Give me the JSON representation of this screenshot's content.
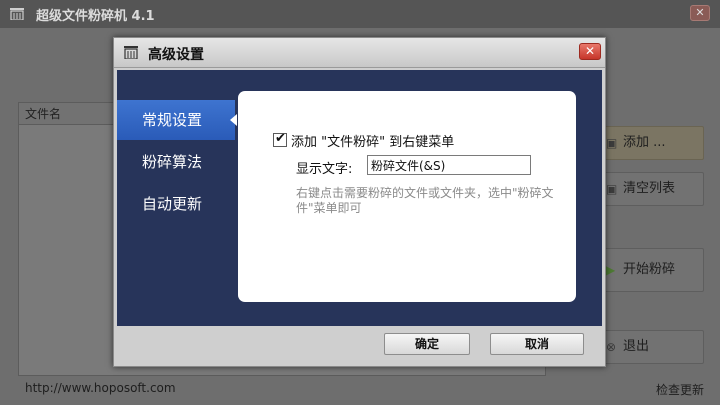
{
  "app": {
    "title": "超级文件粉碎机 4.1",
    "close_glyph": "✕",
    "file_column_header": "文件名",
    "buttons": {
      "add": "添加 ...",
      "clear": "清空列表",
      "start": "开始粉碎",
      "quit": "退出"
    },
    "footer_url": "http://www.hoposoft.com",
    "footer_link": "检查更新"
  },
  "dialog": {
    "title": "高级设置",
    "close_glyph": "✕",
    "nav": [
      {
        "label": "常规设置",
        "active": true
      },
      {
        "label": "粉碎算法",
        "active": false
      },
      {
        "label": "自动更新",
        "active": false
      }
    ],
    "general": {
      "context_menu_option": "添加 \"文件粉碎\" 到右键菜单",
      "context_menu_checked": true,
      "display_text_label": "显示文字:",
      "display_text_value": "粉碎文件(&S)",
      "hint": "右键点击需要粉碎的文件或文件夹，选中\"粉碎文件\"菜单即可"
    },
    "ok_label": "确定",
    "cancel_label": "取消"
  },
  "colors": {
    "nav_active": "#2f63c3",
    "dialog_body": "#27345a",
    "close_button": "#d4473b"
  }
}
